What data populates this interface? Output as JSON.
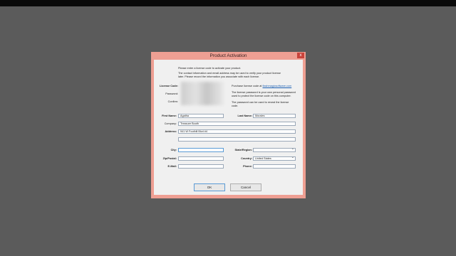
{
  "dialog": {
    "title": "Product Activation",
    "close_glyph": "x",
    "intro1": "Please enter a license code to activate your product.",
    "intro2a": "The contact information and email address may be used to verify your product license",
    "intro2b": "later.  Please record the information you associate with each license.",
    "license_label": "License Code:",
    "password_label": "Password:",
    "confirm_label": "Confirm:",
    "purchase_text": "Purchase license code at",
    "purchase_link": "flashmagicsoftware.com",
    "pw_note1": "The license password is your own personal password",
    "pw_note2": "used to protect the license code on this computer.",
    "reveal1": "The password can be used to reveal the license",
    "reveal2": "code."
  },
  "form": {
    "first_name_label": "First Name:",
    "first_name": "Agatha",
    "last_name_label": "Last Name:",
    "last_name": "Morales",
    "company_label": "Company:",
    "company": "Treasure Booth",
    "address_label": "Address:",
    "address1": "941 W Foothill Blvd #4",
    "address2": "",
    "city_label": "City:",
    "city": "",
    "state_label": "State/Region:",
    "state": "",
    "zip_label": "Zip/Postal:",
    "zip": "",
    "country_label": "Country:",
    "country": "United States",
    "email_label": "E-Mail:",
    "email": "",
    "phone_label": "Phone:",
    "phone": ""
  },
  "buttons": {
    "ok": "OK",
    "cancel": "Cancel"
  },
  "colors": {
    "frame": "#ee9f93",
    "client": "#f0f0f0",
    "backdrop": "#5b5b5b"
  }
}
